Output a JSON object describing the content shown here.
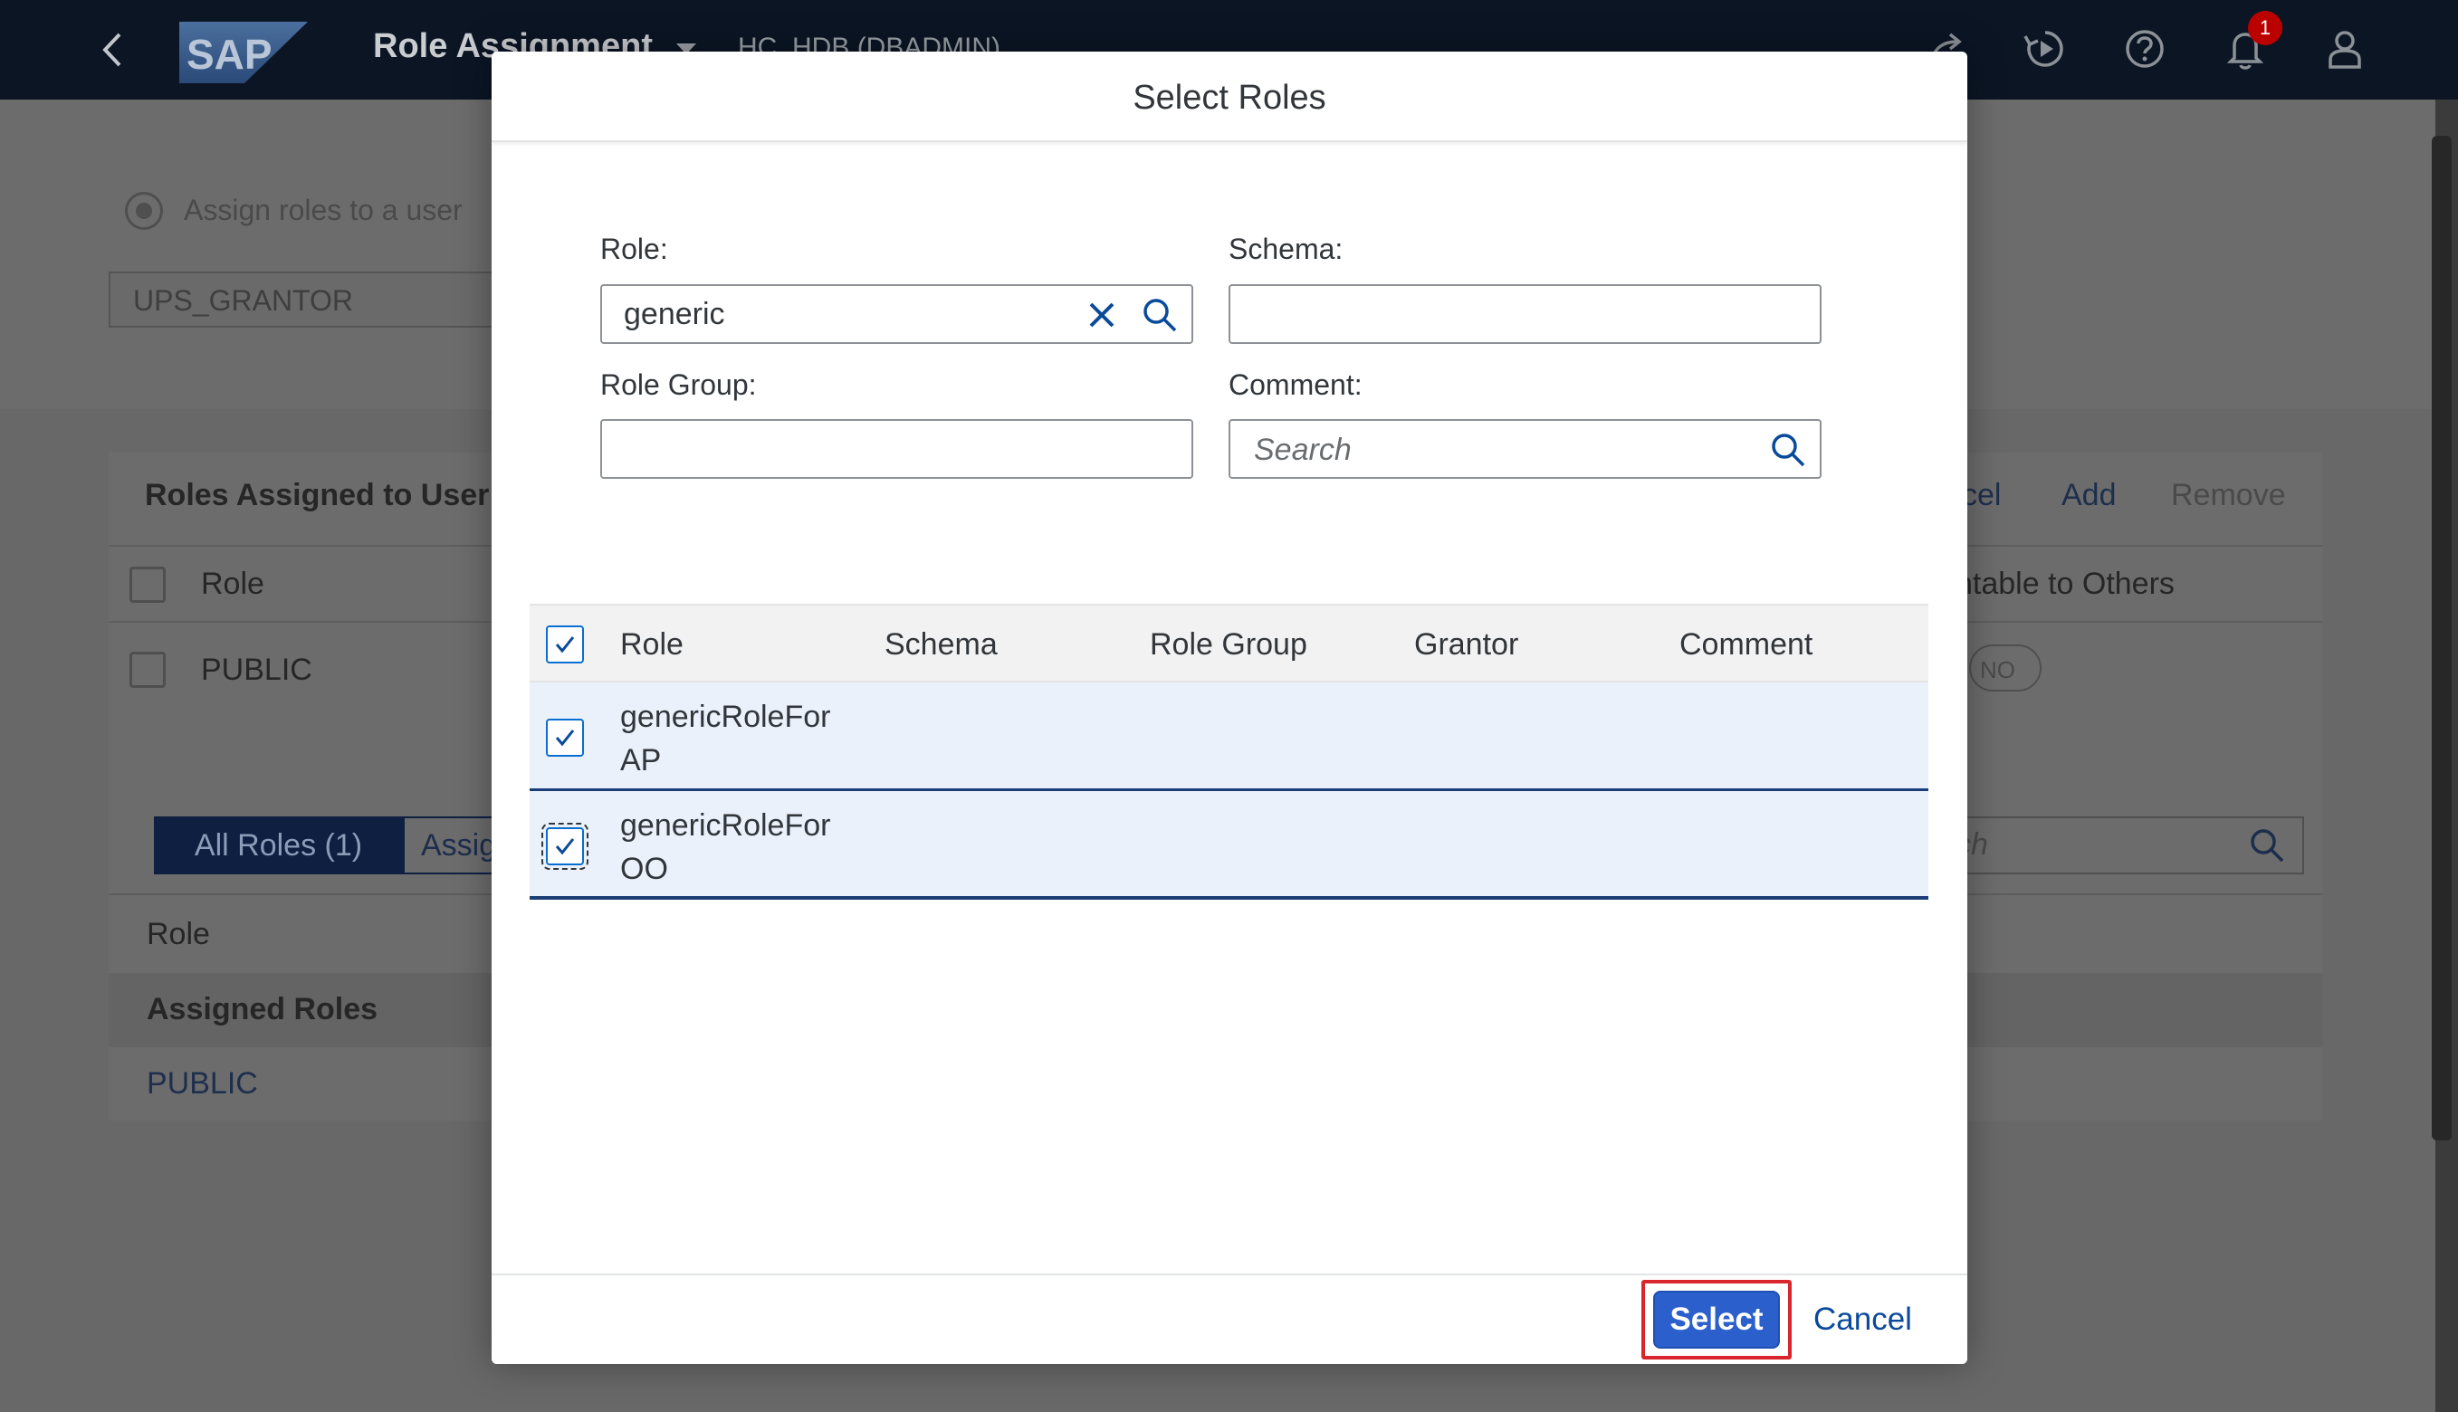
{
  "shell": {
    "title": "Role Assignment",
    "system": "HC_HDB (DBADMIN)",
    "notification_count": "1"
  },
  "background": {
    "assign_option": "Assign roles to a user",
    "user_value": "UPS_GRANTOR",
    "assigned_heading": "Roles Assigned to User",
    "col_role": "Role",
    "grantable_header": "ntable to Others",
    "public_role": "PUBLIC",
    "toggle_no": "NO",
    "action_cancel": "cel",
    "action_add": "Add",
    "action_remove": "Remove",
    "tab_all_roles": "All Roles (1)",
    "tab_assigned": "Assig",
    "search_fragment": "ch",
    "list_role_header": "Role",
    "group_assigned_roles": "Assigned Roles",
    "list_public": "PUBLIC"
  },
  "dialog": {
    "title": "Select Roles",
    "filters": {
      "role_label": "Role:",
      "role_value": "generic",
      "schema_label": "Schema:",
      "schema_value": "",
      "role_group_label": "Role Group:",
      "role_group_value": "",
      "comment_label": "Comment:",
      "comment_placeholder": "Search"
    },
    "table": {
      "columns": [
        "Role",
        "Schema",
        "Role Group",
        "Grantor",
        "Comment"
      ],
      "rows": [
        {
          "role_line1": "genericRoleFor",
          "role_line2": "AP",
          "selected": true
        },
        {
          "role_line1": "genericRoleFor",
          "role_line2": "OO",
          "selected": true
        }
      ]
    },
    "footer": {
      "select_label": "Select",
      "cancel_label": "Cancel"
    }
  },
  "colors": {
    "shell_bg": "#0b1524",
    "emphasized_button": "#2a5fcc",
    "selected_row": "#eaf1fb",
    "highlight_frame": "#d9262c"
  }
}
